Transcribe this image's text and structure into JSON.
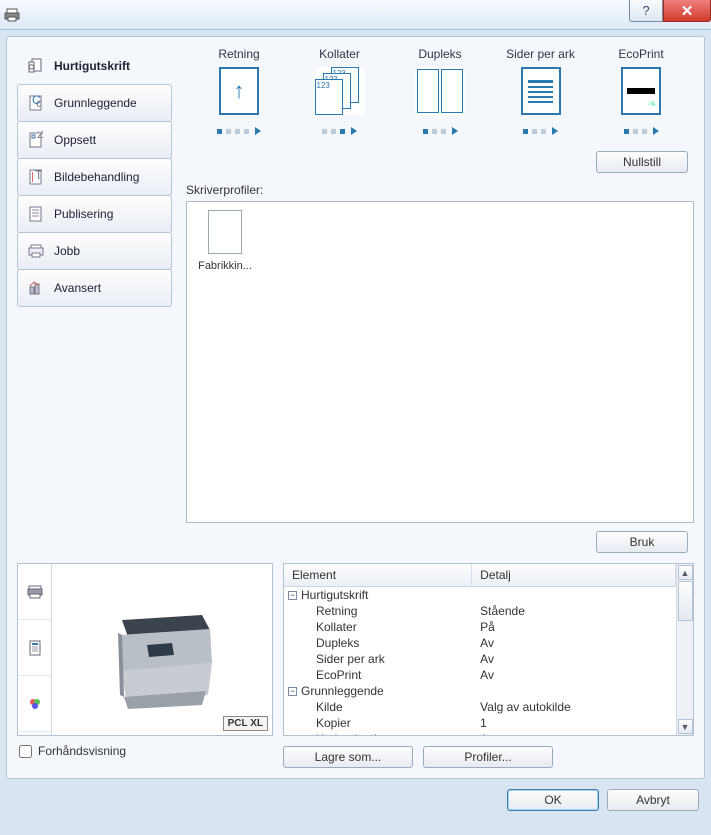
{
  "titlebar": {
    "help_glyph": "?",
    "close_glyph": "✕"
  },
  "sidebar": {
    "items": [
      {
        "label": "Hurtigutskrift"
      },
      {
        "label": "Grunnleggende"
      },
      {
        "label": "Oppsett"
      },
      {
        "label": "Bildebehandling"
      },
      {
        "label": "Publisering"
      },
      {
        "label": "Jobb"
      },
      {
        "label": "Avansert"
      }
    ]
  },
  "options": {
    "retning_label": "Retning",
    "kollater_label": "Kollater",
    "dupleks_label": "Dupleks",
    "sider_label": "Sider per ark",
    "ecoprint_label": "EcoPrint",
    "reset_label": "Nullstill"
  },
  "profiles": {
    "label": "Skriverprofiler:",
    "item0": "Fabrikkin...",
    "use_label": "Bruk"
  },
  "details": {
    "header_element": "Element",
    "header_detail": "Detalj",
    "rows": [
      {
        "group": true,
        "el": "Hurtigutskrift",
        "de": ""
      },
      {
        "child": true,
        "el": "Retning",
        "de": "Stående"
      },
      {
        "child": true,
        "el": "Kollater",
        "de": "På"
      },
      {
        "child": true,
        "el": "Dupleks",
        "de": "Av"
      },
      {
        "child": true,
        "el": "Sider per ark",
        "de": "Av"
      },
      {
        "child": true,
        "el": "EcoPrint",
        "de": "Av"
      },
      {
        "group": true,
        "el": "Grunnleggende",
        "de": ""
      },
      {
        "child": true,
        "el": "Kilde",
        "de": "Valg av autokilde"
      },
      {
        "child": true,
        "el": "Kopier",
        "de": "1"
      },
      {
        "child": true,
        "el": "Karbonkopier",
        "de": "Av"
      }
    ]
  },
  "preview": {
    "pcl_label": "PCL XL",
    "checkbox_label": "Forhåndsvisning",
    "save_as_label": "Lagre som...",
    "profiles_btn_label": "Profiler..."
  },
  "dialog": {
    "ok": "OK",
    "cancel": "Avbryt"
  }
}
